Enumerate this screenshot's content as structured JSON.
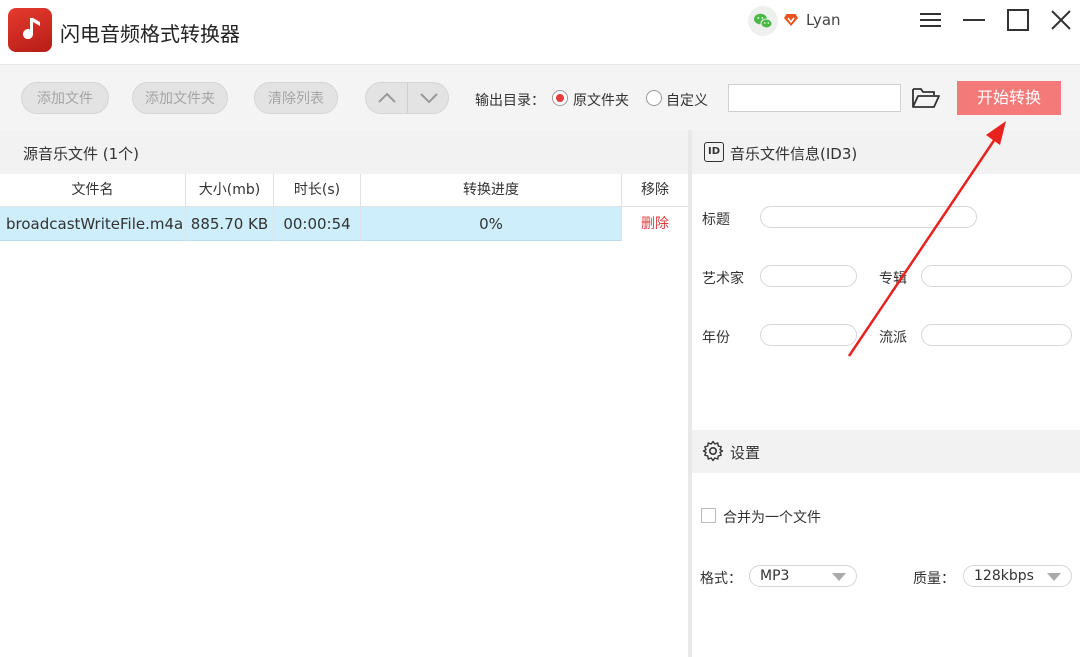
{
  "app": {
    "title": "闪电音频格式转换器",
    "user": "Lyan"
  },
  "toolbar": {
    "add_file": "添加文件",
    "add_folder": "添加文件夹",
    "clear_list": "清除列表",
    "output_dir_label": "输出目录：",
    "radio_original": "原文件夹",
    "radio_custom": "自定义",
    "output_path": "",
    "start_button": "开始转换"
  },
  "source_panel": {
    "header": "源音乐文件 (1个)",
    "columns": [
      "文件名",
      "大小(mb)",
      "时长(s)",
      "转换进度",
      "移除"
    ],
    "rows": [
      {
        "filename": "broadcastWriteFile.m4a",
        "size": "885.70 KB",
        "duration": "00:00:54",
        "progress": "0%",
        "remove": "删除"
      }
    ]
  },
  "id3_panel": {
    "header": "音乐文件信息(ID3)",
    "id_badge": "ID",
    "fields": {
      "title": "标题",
      "artist": "艺术家",
      "album": "专辑",
      "year": "年份",
      "genre": "流派"
    }
  },
  "settings": {
    "header": "设置",
    "merge_label": "合并为一个文件",
    "merge_checked": false,
    "format_label": "格式：",
    "format_value": "MP3",
    "quality_label": "质量：",
    "quality_value": "128kbps"
  },
  "colors": {
    "accent": "#e83b3b",
    "start_button": "#f47a7a",
    "row_selected": "#cdeefa",
    "annotation_arrow": "#e8231f"
  }
}
